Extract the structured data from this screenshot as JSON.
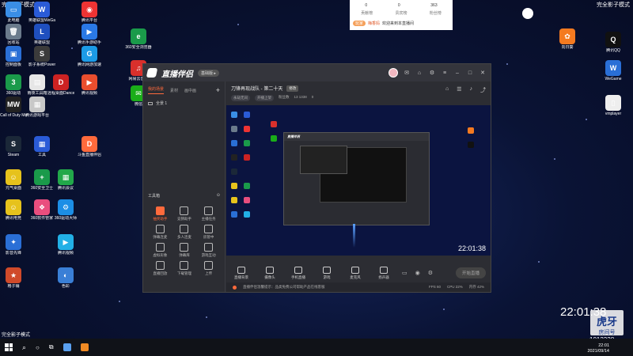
{
  "corner": {
    "left_label": "完全影子模式",
    "right_label": "完全影子模式"
  },
  "desktop_icons": [
    {
      "label": "此电脑",
      "color": "#3a8ee6",
      "glyph": "▭"
    },
    {
      "label": "英雄联盟WeGame版",
      "color": "#2a5bd7",
      "glyph": "W"
    },
    {
      "label": "腾讯平台",
      "color": "#e33",
      "glyph": "◉"
    },
    {
      "label": "回收站",
      "color": "#6b7b8c",
      "glyph": "🗑"
    },
    {
      "label": "英雄联盟",
      "color": "#1f4fbf",
      "glyph": "L"
    },
    {
      "label": "腾讯手游助手",
      "color": "#2a79e6",
      "glyph": "▶"
    },
    {
      "label": "控制面板",
      "color": "#2a6fd6",
      "glyph": "▣"
    },
    {
      "label": "影子系统PowerSh...",
      "color": "#3b3b3b",
      "glyph": "S"
    },
    {
      "label": "腾讯网游加速",
      "color": "#1c9be6",
      "glyph": "G"
    },
    {
      "label": "360驱动",
      "color": "#1a9a4a",
      "glyph": "3"
    },
    {
      "label": "雨夜工具箱",
      "color": "#e6e6e6",
      "glyph": "▤"
    },
    {
      "label": "远程桌面Dance of...",
      "color": "#c22",
      "glyph": "D"
    },
    {
      "label": "腾讯视频",
      "color": "#e94e2e",
      "glyph": "▶"
    },
    {
      "label": "Call of Duty Modern...",
      "color": "#222",
      "glyph": "MW"
    },
    {
      "label": "腾讯游戏平台",
      "color": "#c8c8c8",
      "glyph": "▦"
    },
    {
      "label": "Steam",
      "color": "#1b2838",
      "glyph": "S"
    },
    {
      "label": "工具",
      "color": "#2a5bd7",
      "glyph": "▦"
    },
    {
      "label": "斗鱼直播伴侣",
      "color": "#ff6a3c",
      "glyph": "D"
    },
    {
      "label": "元气桌面",
      "color": "#e6c21c",
      "glyph": "☺"
    },
    {
      "label": "360安全卫士",
      "color": "#1a9a4a",
      "glyph": "+"
    },
    {
      "label": "腾讯会议",
      "color": "#22a84a",
      "glyph": "▦"
    },
    {
      "label": "腾讯电竞",
      "color": "#e6c21c",
      "glyph": "☺"
    },
    {
      "label": "360软件管家",
      "color": "#e94e7e",
      "glyph": "❖"
    },
    {
      "label": "360驱动大师",
      "color": "#1c8ee6",
      "glyph": "⚙"
    },
    {
      "label": "影音先锋",
      "color": "#2a6fd6",
      "glyph": "✦"
    },
    {
      "label": "腾讯视频",
      "color": "#22b0e6",
      "glyph": "▶"
    },
    {
      "label": "格子铺",
      "color": "#d04a2a",
      "glyph": "★"
    },
    {
      "label": "色彩",
      "color": "#3a7fd6",
      "glyph": "◐"
    },
    {
      "label": "360安全浏览器",
      "color": "#1a9a4a",
      "glyph": "e"
    },
    {
      "label": "网易云音乐",
      "color": "#d9302c",
      "glyph": "♫"
    },
    {
      "label": "微信",
      "color": "#1aad19",
      "glyph": "✉"
    },
    {
      "label": "向日葵",
      "color": "#f47a20",
      "glyph": "✿"
    },
    {
      "label": "腾讯QQ",
      "color": "#111",
      "glyph": "Q"
    },
    {
      "label": "WeGame",
      "color": "#2a6fd6",
      "glyph": "W"
    },
    {
      "label": "vmplayer",
      "color": "#eee",
      "glyph": "▯"
    }
  ],
  "notification": {
    "stats_top": [
      "0",
      "0",
      "363"
    ],
    "stats_bottom": [
      "贡献榜",
      "贵宾榜",
      "粉丝榜"
    ],
    "tag": "玩家",
    "user": "梅香妈",
    "message": "欢迎来到本直播间"
  },
  "app": {
    "title": "直播伴侣",
    "badge": "基础版 ▸",
    "tabs": [
      "我的场景",
      "素材",
      "画中画"
    ],
    "scene_label": "全景 1",
    "room_title": "刀锋再现战队 - 第二十天",
    "room_title_tag": "修改",
    "meta_chips": [
      "永劫无间",
      "开播上架"
    ],
    "meta_items": [
      "粉丝数",
      "13 1338",
      "0"
    ],
    "toolbox_label": "工具箱",
    "tools": [
      {
        "label": "抽奖助手",
        "hot": true
      },
      {
        "label": "竞猜助手",
        "hot": false
      },
      {
        "label": "主播任务",
        "hot": false
      },
      {
        "label": "弹幕连麦",
        "hot": false
      },
      {
        "label": "多人连麦",
        "hot": false
      },
      {
        "label": "房管中",
        "hot": false
      },
      {
        "label": "虚拟形象",
        "hot": false
      },
      {
        "label": "弹幕库",
        "hot": false
      },
      {
        "label": "游戏互动",
        "hot": false
      },
      {
        "label": "直播回放",
        "hot": false
      },
      {
        "label": "下载管理",
        "hot": false
      },
      {
        "label": "上传",
        "hot": false
      }
    ],
    "preview_time": "22:01:38",
    "controls": [
      "直播背景",
      "摄像头",
      "手机直播",
      "游戏",
      "麦克风",
      "扬声器"
    ],
    "live_button": "开始直播",
    "footer_message": "直播伴侣温馨提示：品类免费公司帮助产品在线客服",
    "footer_stats": [
      "FPS 60",
      "CPU 22%",
      "内存 42%"
    ]
  },
  "overlay": {
    "clock": "22:01:38",
    "room_id": "1013338",
    "huya_top": "虎牙",
    "huya_label": "房间号"
  },
  "taskbar": {
    "time": "22:01",
    "date": "2021/09/14"
  }
}
